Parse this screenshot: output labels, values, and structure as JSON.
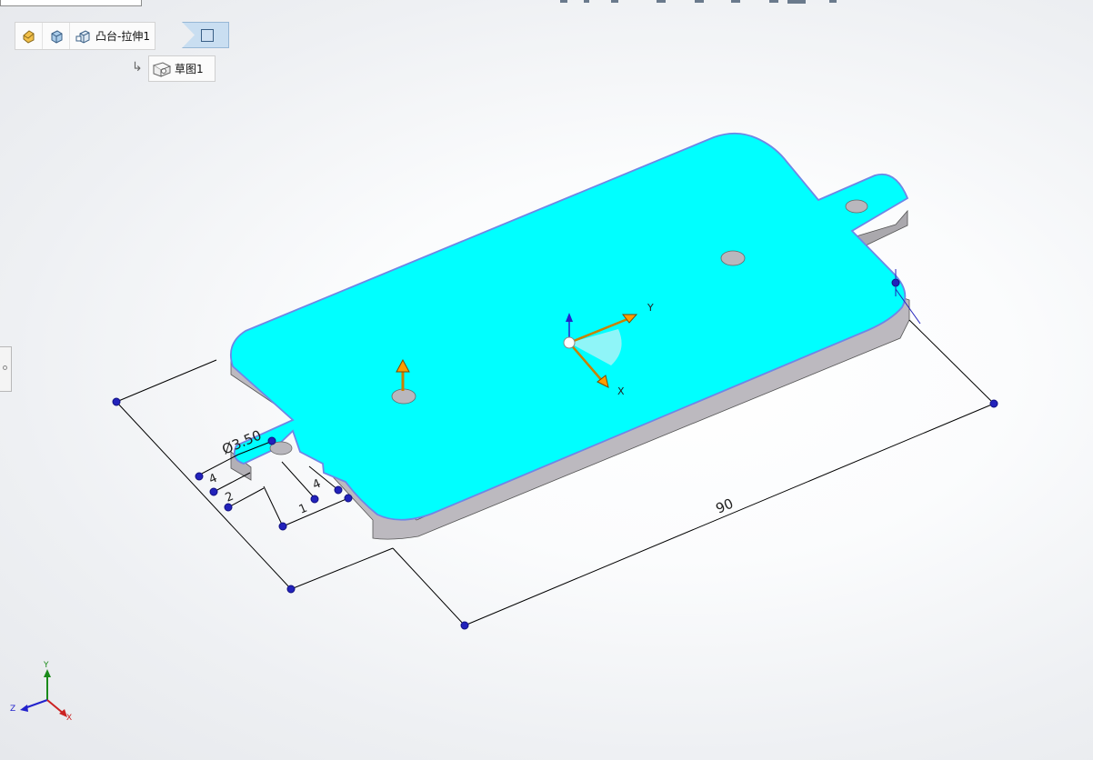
{
  "breadcrumb": {
    "feature_label": "凸台-拉伸1",
    "sketch_label": "草图1"
  },
  "dimensions": {
    "length": "90",
    "hole_diameter": "Ø3.50",
    "dim_a": "4",
    "dim_b": "2",
    "dim_c": "4",
    "dim_d": "1"
  },
  "axes": {
    "x": "X",
    "y": "Y",
    "z": "Z"
  },
  "colors": {
    "face": "#00ffff",
    "face_edge": "#6f86e6",
    "side": "#bcb9bf",
    "dimension_line": "#000000",
    "point": "#2222bb",
    "drag_arrow": "#ff9c00"
  }
}
